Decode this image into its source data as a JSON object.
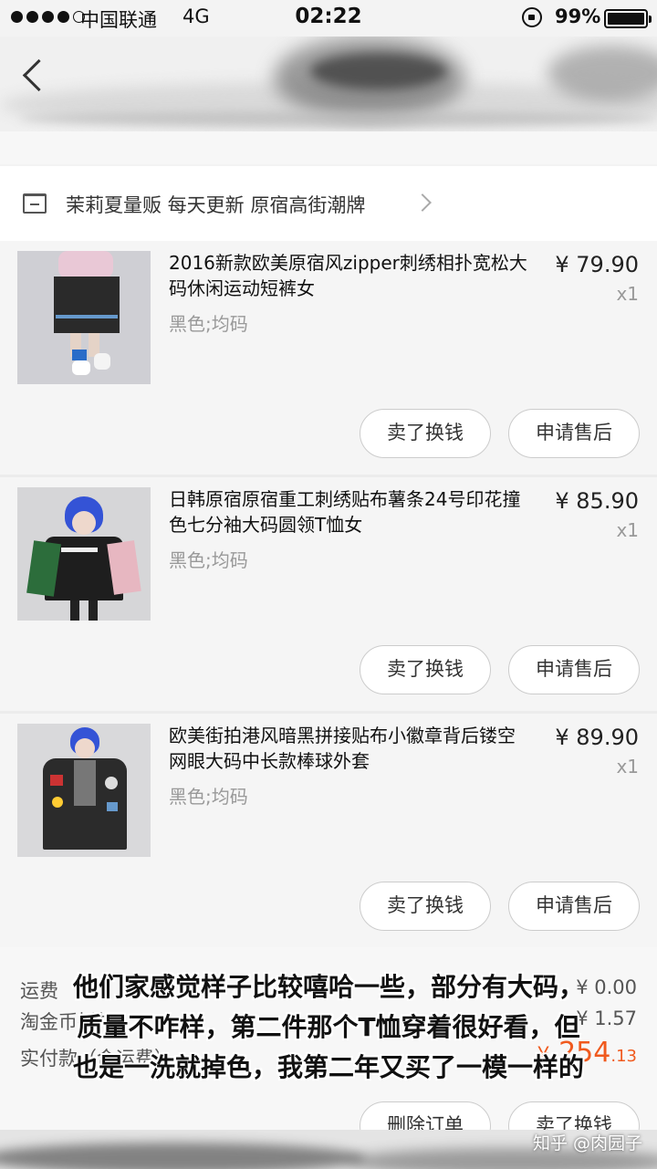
{
  "status_bar": {
    "carrier": "中国联通",
    "network": "4G",
    "time": "02:22",
    "battery_percent": "99%",
    "battery_level": 0.99
  },
  "shop": {
    "name": "茉莉夏量贩 每天更新 原宿高街潮牌",
    "icon": "store-icon"
  },
  "items": [
    {
      "title": "2016新款欧美原宿风zipper刺绣相扑宽松大码休闲运动短裤女",
      "sku": "黑色;均码",
      "price": "¥ 79.90",
      "qty": "x1",
      "btn_sell": "卖了换钱",
      "btn_after": "申请售后"
    },
    {
      "title": "日韩原宿原宿重工刺绣贴布薯条24号印花撞色七分袖大码圆领T恤女",
      "sku": "黑色;均码",
      "price": "¥ 85.90",
      "qty": "x1",
      "btn_sell": "卖了换钱",
      "btn_after": "申请售后"
    },
    {
      "title": "欧美街拍港风暗黑拼接贴布小徽章背后镂空网眼大码中长款棒球外套",
      "sku": "黑色;均码",
      "price": "¥ 89.90",
      "qty": "x1",
      "btn_sell": "卖了换钱",
      "btn_after": "申请售后"
    }
  ],
  "summary": {
    "row1_label": "运费",
    "row1_value": "¥ 0.00",
    "row2_label": "淘金币抵扣",
    "row2_value": "¥ 1.57",
    "row3_label": "实付款（含运费）",
    "row3_currency": "¥",
    "row3_value_int": "254",
    "row3_value_dec": ".13",
    "delete_btn": "删除订单",
    "sell_btn": "卖了换钱"
  },
  "caption": {
    "line1": "他们家感觉样子比较嘻哈一些，部分有大码，",
    "line2": "质量不咋样，第二件那个T恤穿着很好看，但",
    "line3": "也是一洗就掉色，我第二年又买了一模一样的"
  },
  "watermark": "知乎 @肉园子",
  "colors": {
    "accent": "#f05a1e",
    "background": "#f3f3f3"
  }
}
